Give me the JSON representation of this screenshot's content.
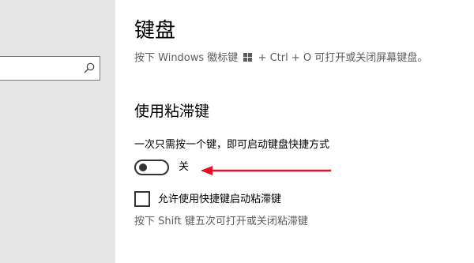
{
  "sidebar": {
    "search": {
      "placeholder": "",
      "value": ""
    }
  },
  "main": {
    "title": "键盘",
    "description_prefix": "按下 Windows 徽标键",
    "description_suffix": "+ Ctrl + O 可打开或关闭屏幕键盘。",
    "sticky_keys": {
      "section_title": "使用粘滞键",
      "toggle_description": "一次只需按一个键，即可启动键盘快捷方式",
      "toggle_state_label": "关",
      "toggle_on": false,
      "shortcut_checkbox_label": "允许使用快捷键启动粘滞键",
      "shortcut_checkbox_checked": false,
      "shortcut_hint": "按下 Shift 键五次可打开或关闭粘滞键"
    }
  },
  "annotation": {
    "arrow_color": "#e81123"
  },
  "colors": {
    "sidebar_bg": "#e6e6e6",
    "secondary_text": "#5c5c5c"
  }
}
